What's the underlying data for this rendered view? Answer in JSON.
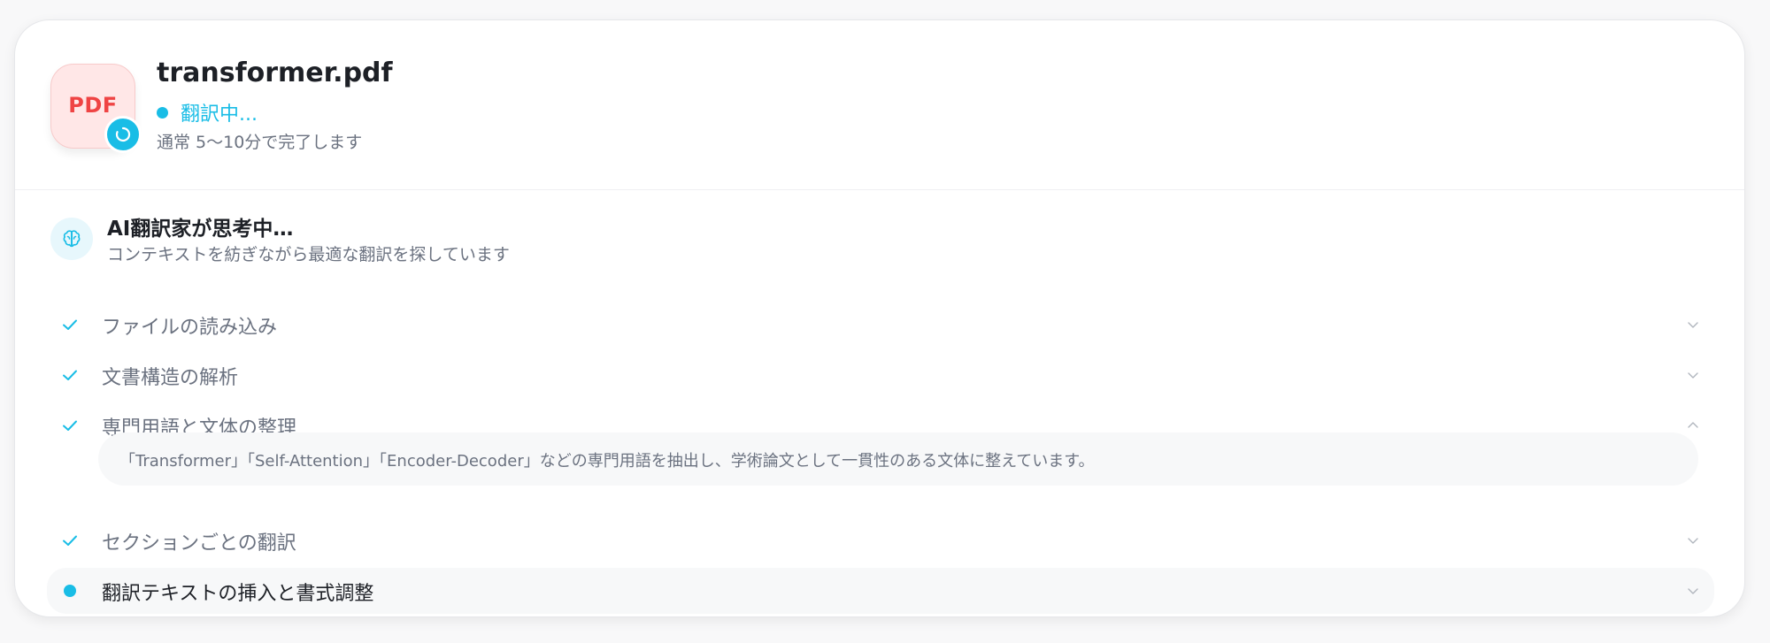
{
  "file": {
    "thumb_label": "PDF",
    "name": "transformer.pdf",
    "status": "翻訳中...",
    "eta": "通常 5〜10分で完了します"
  },
  "thinking": {
    "title": "AI翻訳家が思考中…",
    "subtitle": "コンテキストを紡ぎながら最適な翻訳を探しています"
  },
  "steps": [
    {
      "label": "ファイルの読み込み",
      "state": "done",
      "expanded": false
    },
    {
      "label": "文書構造の解析",
      "state": "done",
      "expanded": false
    },
    {
      "label": "専門用語と文体の整理",
      "state": "done",
      "expanded": true,
      "detail": "「Transformer」「Self-Attention」「Encoder-Decoder」などの専門用語を抽出し、学術論文として一貫性のある文体に整えています。"
    },
    {
      "label": "セクションごとの翻訳",
      "state": "done",
      "expanded": false
    },
    {
      "label": "翻訳テキストの挿入と書式調整",
      "state": "in-progress",
      "expanded": false
    }
  ],
  "icons": {
    "spinner": "loading-spinner-icon",
    "brain": "brain-icon",
    "check": "check-icon",
    "chevron_down": "chevron-down-icon",
    "chevron_up": "chevron-up-icon"
  },
  "colors": {
    "accent": "#19bde6",
    "pdf_red": "#ef4444",
    "pdf_bg": "#ffe7e7",
    "muted_text": "#6b7280",
    "heading_text": "#1d2026"
  }
}
